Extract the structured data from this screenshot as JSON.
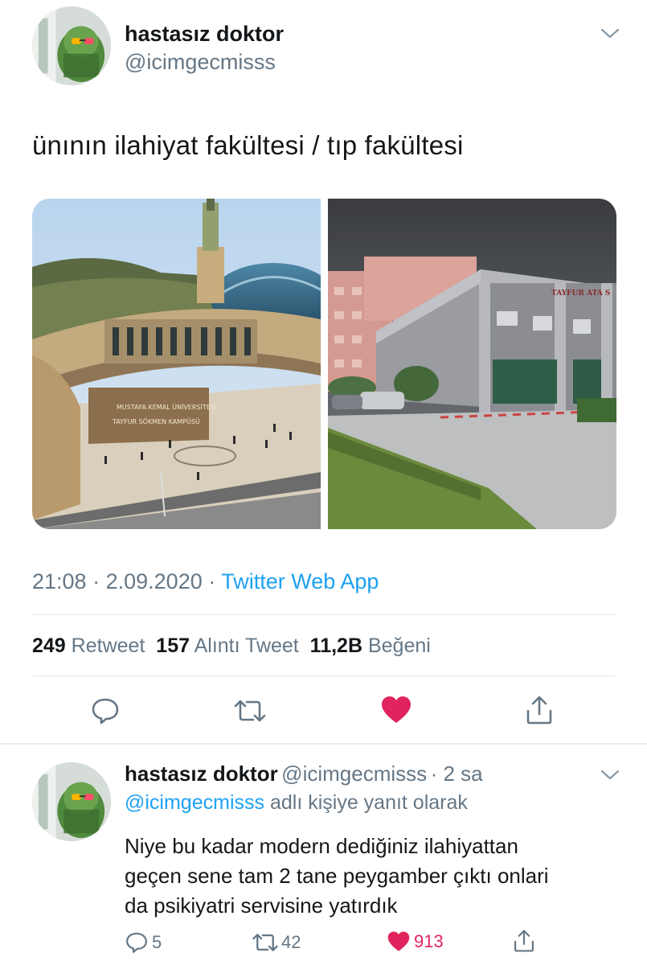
{
  "tweet": {
    "author_name": "hastasız doktor",
    "author_handle": "@icimgecmisss",
    "text": "ünının ilahiyat fakültesi / tıp fakültesi",
    "time": "21:08",
    "separator": "·",
    "date": "2.09.2020",
    "source": "Twitter Web App",
    "stats": {
      "retweets_count": "249",
      "retweets_label": "Retweet",
      "quotes_count": "157",
      "quotes_label": "Alıntı Tweet",
      "likes_count": "11,2B",
      "likes_label": "Beğeni"
    },
    "liked": true
  },
  "reply": {
    "author_name": "hastasız doktor",
    "author_handle": "@icimgecmisss",
    "age": "· 2 sa",
    "replying_to_handle": "@icimgecmisss",
    "replying_to_suffix": "adlı kişiye yanıt olarak",
    "lines": [
      "Niye bu kadar modern dediğiniz ilahiyattan",
      "geçen sene tam 2 tane peygamber çıktı onlari",
      "da psikiyatri servisine yatırdık"
    ],
    "counts": {
      "replies": "5",
      "retweets": "42",
      "likes": "913"
    }
  },
  "media": {
    "left_sign_line1": "MUSTAFA KEMAL ÜNİVERSİTESİ",
    "left_sign_line2": "TAYFUR SÖKMEN KAMPÜSÜ",
    "right_sign": "TAYFUR ATA S"
  },
  "colors": {
    "like": "#e0245e",
    "link": "#1da1f2",
    "secondary": "#657786",
    "divider": "#e1e8ed"
  },
  "icons": [
    "chevron-down-icon",
    "reply-icon",
    "retweet-icon",
    "heart-icon",
    "share-icon"
  ]
}
